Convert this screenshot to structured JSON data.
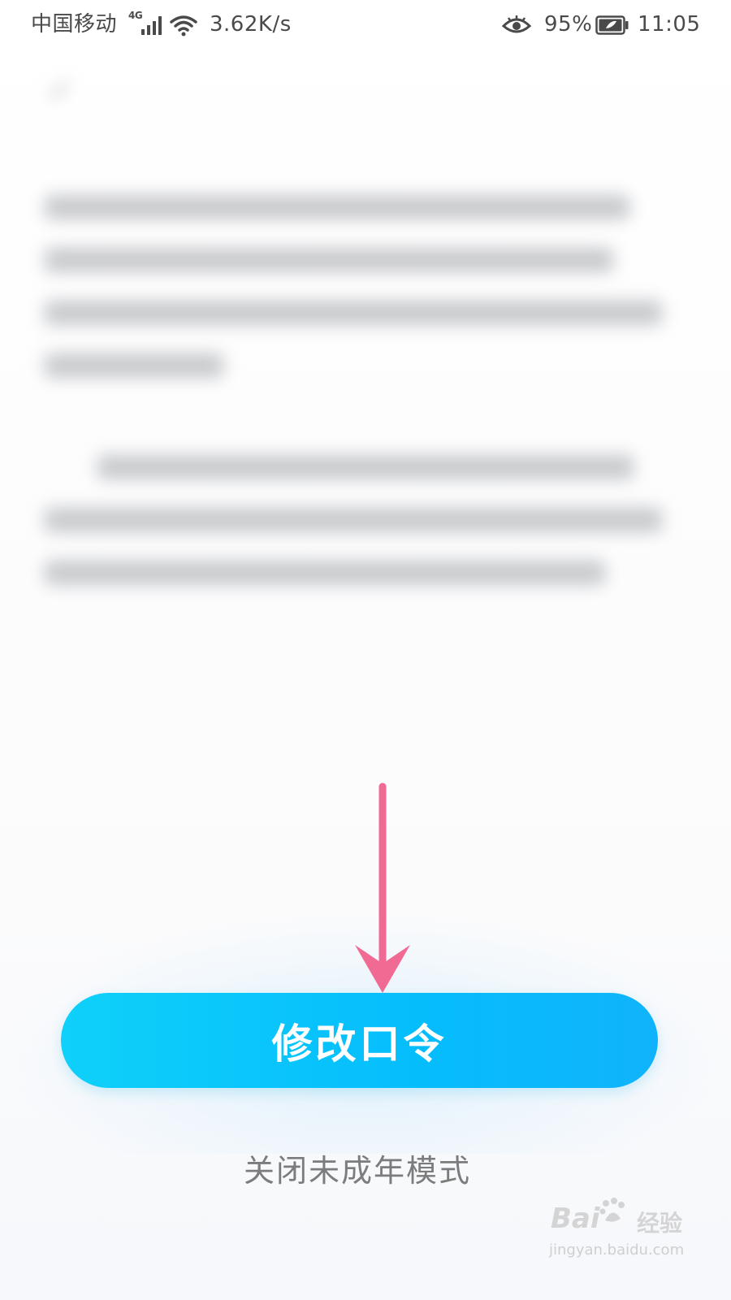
{
  "status_bar": {
    "carrier": "中国移动",
    "network_type": "4G",
    "net_speed": "3.62K/s",
    "battery_percent": "95%",
    "time": "11:05"
  },
  "main": {
    "primary_button_label": "修改口令",
    "secondary_link_label": "关闭未成年模式"
  },
  "watermark": {
    "logo_text": "Bai",
    "logo_word": "经验",
    "url": "jingyan.baidu.com"
  },
  "colors": {
    "primary_button": "#06bdfc",
    "arrow": "#f06a93",
    "secondary_text": "#7c7c7c"
  }
}
